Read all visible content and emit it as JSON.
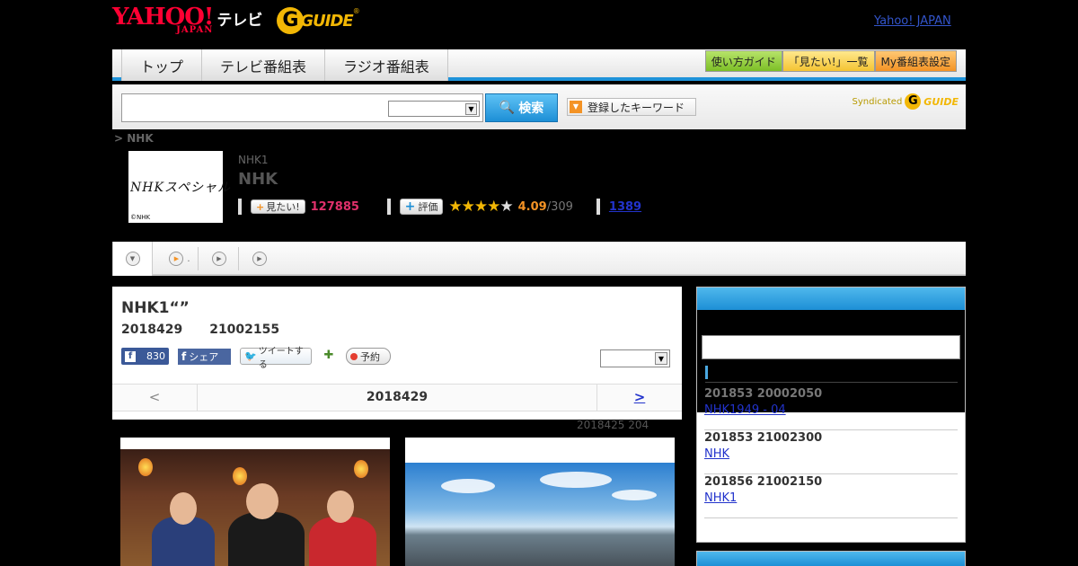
{
  "header": {
    "yahoo_logo": "YAHOO!",
    "yahoo_japan": "JAPAN",
    "tv_label": "テレビ",
    "gguide_logo": "G",
    "gguide_text": "GUIDE",
    "yahoo_japan_link": "Yahoo! JAPAN"
  },
  "nav": {
    "tabs": [
      "トップ",
      "テレビ番組表",
      "ラジオ番組表"
    ],
    "right_buttons": [
      "使い方ガイド",
      "「見たい!」一覧",
      "My番組表設定"
    ]
  },
  "search": {
    "button_label": "検索",
    "keyword_button": "登録したキーワード",
    "syndicated": "Syndicated",
    "syndicated_logo": "GUIDE"
  },
  "breadcrumb": "> NHK",
  "program": {
    "thumb_logo": "NHKスペシャル",
    "thumb_copyright": "©NHK",
    "channel": "NHK1",
    "title": "NHK",
    "mitai_label": "見たい!",
    "mitai_count": "127885",
    "hyoka_label": "評価",
    "rating": "4.09",
    "rating_count": "/309",
    "review_link": "1389",
    "stars_filled": 4
  },
  "card": {
    "title": "NHK1“”",
    "date": "2018429",
    "time": "21002155",
    "fb_like_count": "830",
    "fb_share": "シェア",
    "tweet": "ツイートする",
    "yoyaku": "予約",
    "prev": "<",
    "current_date": "2018429",
    "next": ">",
    "updated": "2018425  204"
  },
  "sidebar": {
    "entries": [
      {
        "date": "201853  20002050",
        "link": "NHK1949 - 04"
      },
      {
        "date": "201853  21002300",
        "link": "NHK"
      },
      {
        "date": "201856  21002150",
        "link": "NHK1"
      }
    ]
  },
  "colors": {
    "accent_blue": "#1d8fd6",
    "mitai_pink": "#e0306b",
    "rating_orange": "#f49325",
    "gguide_yellow": "#f2b705"
  }
}
